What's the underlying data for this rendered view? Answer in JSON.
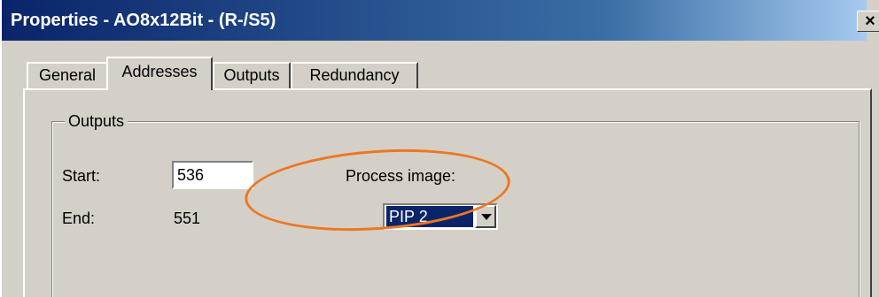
{
  "window": {
    "title": "Properties - AO8x12Bit - (R-/S5)",
    "close_glyph": "×"
  },
  "tabs": [
    {
      "label": "General",
      "active": false
    },
    {
      "label": "Addresses",
      "active": true
    },
    {
      "label": "Outputs",
      "active": false
    },
    {
      "label": "Redundancy",
      "active": false
    }
  ],
  "outputs_group": {
    "legend": "Outputs",
    "start_label": "Start:",
    "start_value": "536",
    "end_label": "End:",
    "end_value": "551",
    "process_image_label": "Process image:",
    "process_image_value": "PIP 2"
  },
  "colors": {
    "titlebar": "#0a246a",
    "dialog": "#d4d0c8",
    "selection": "#0a246a",
    "annotation": "#ee7622"
  }
}
